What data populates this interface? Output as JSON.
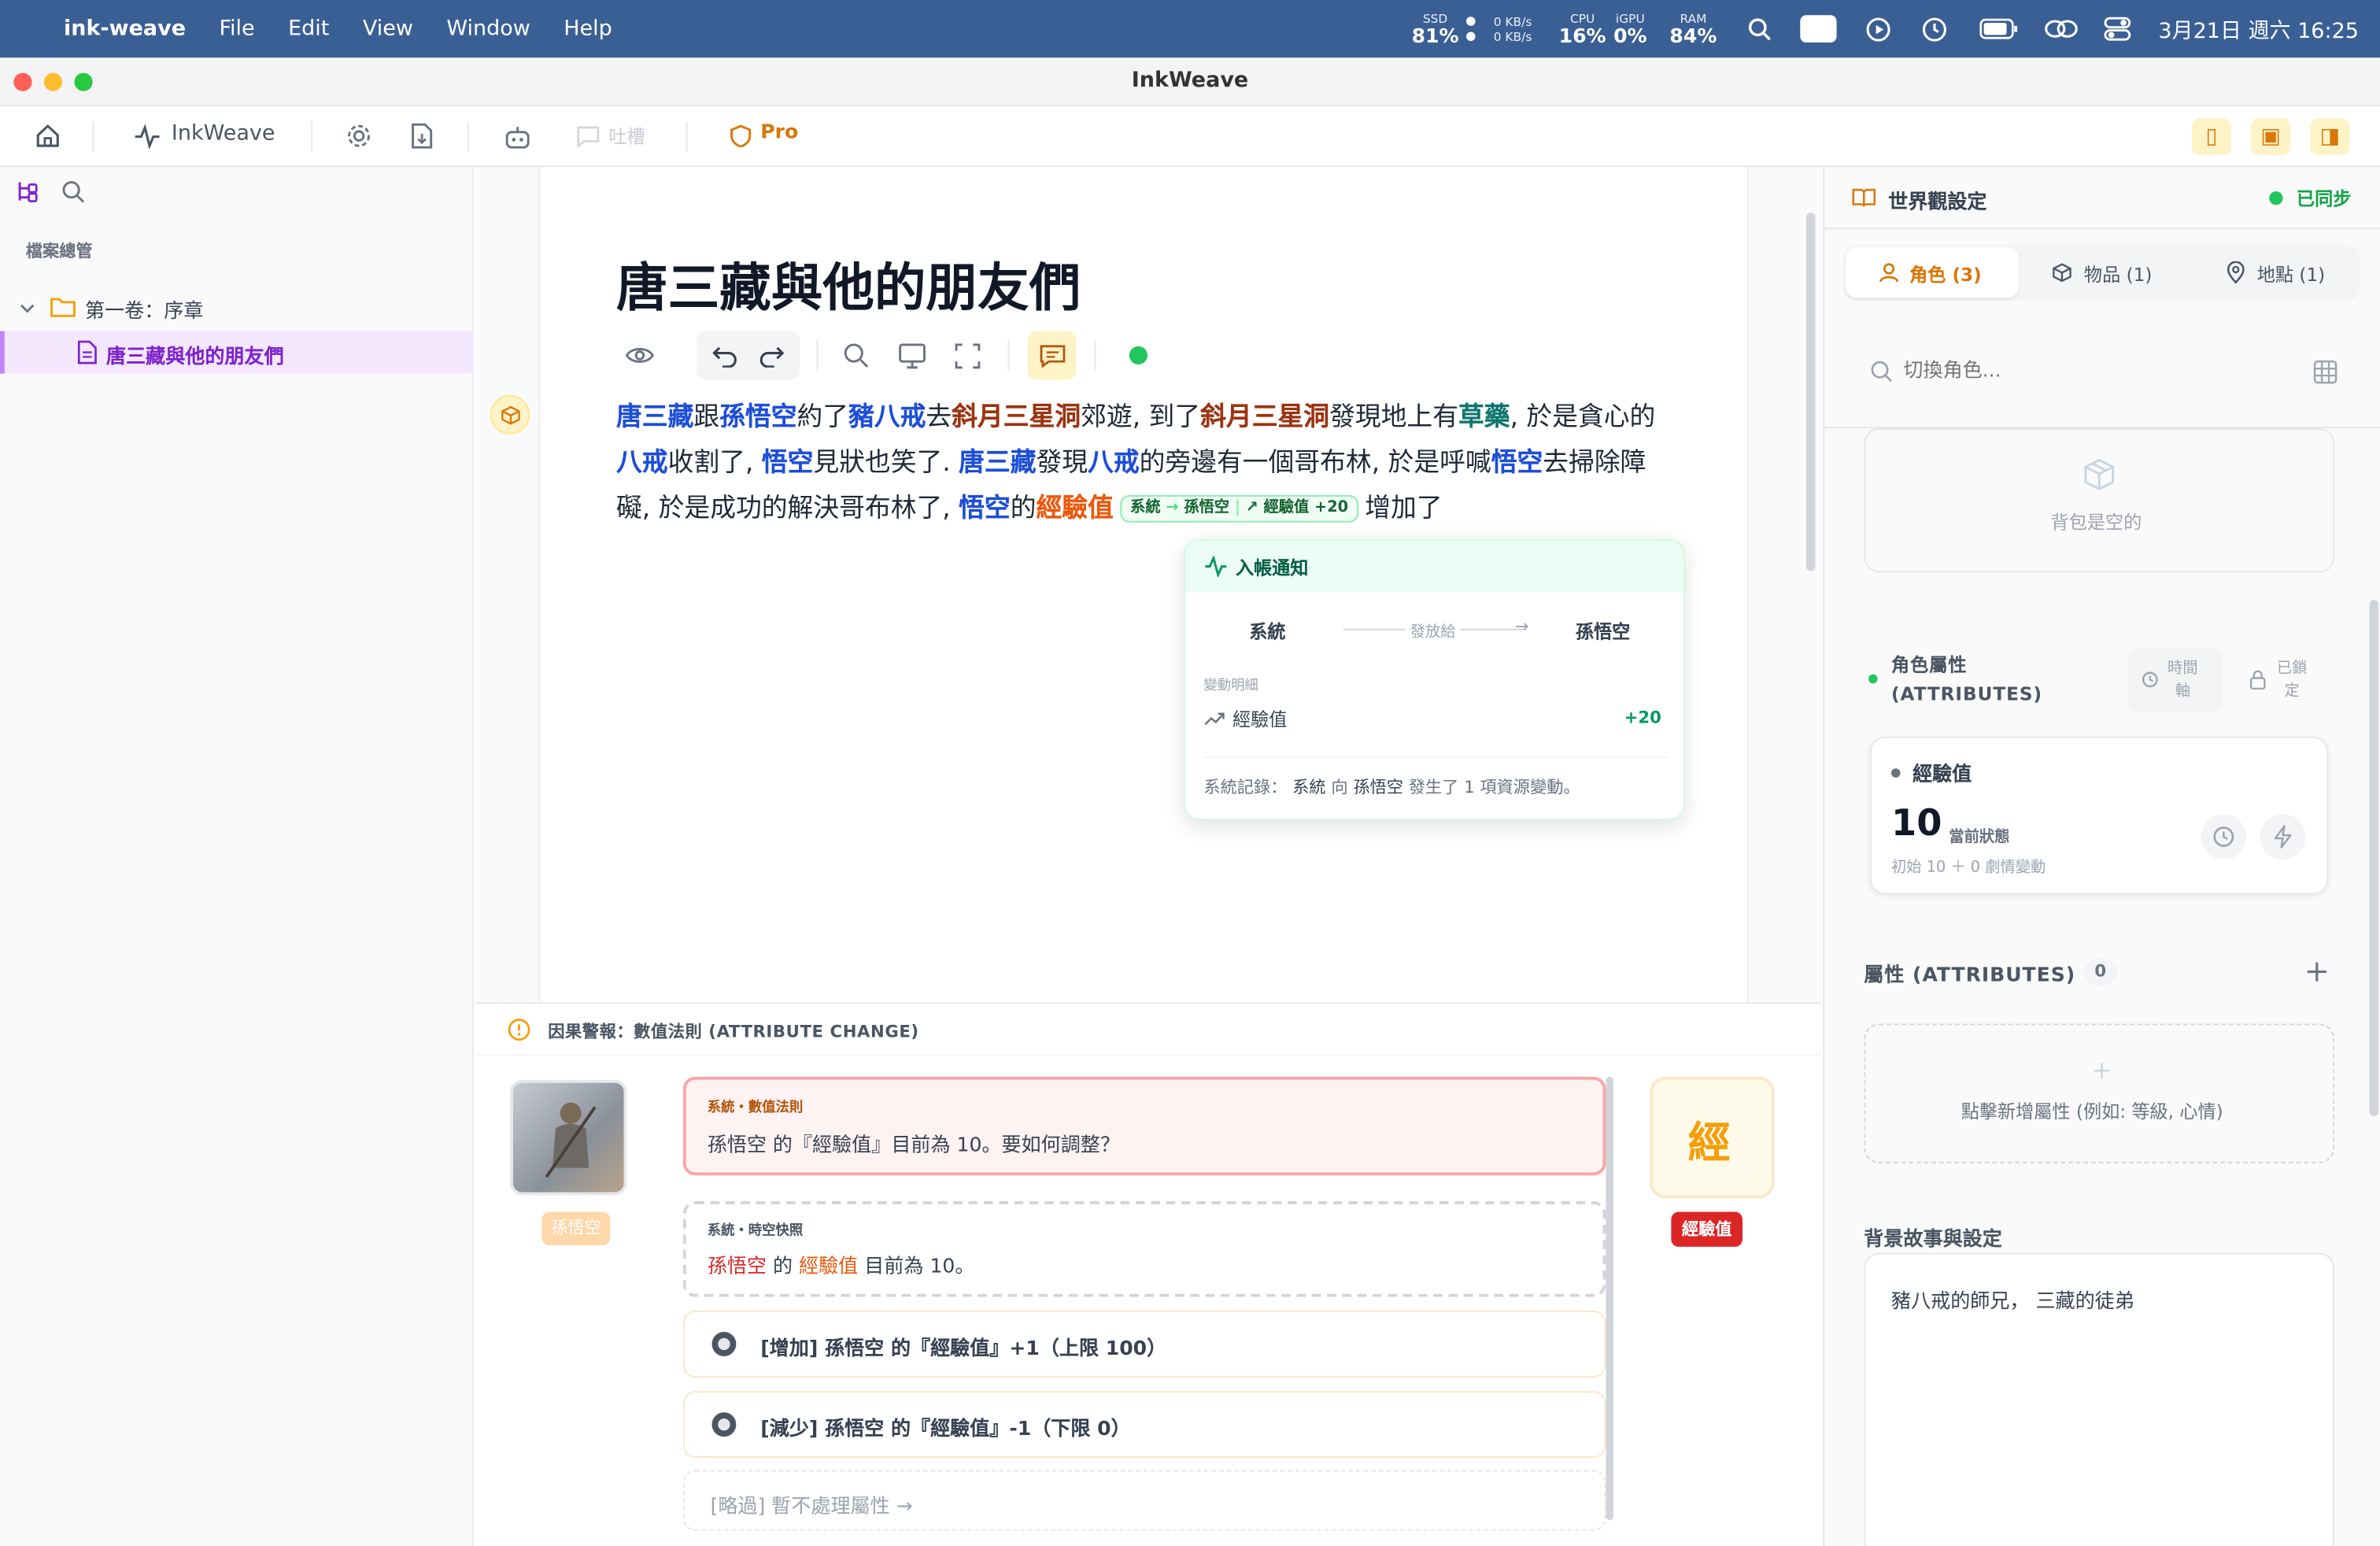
{
  "menubar": {
    "app_name": "ink-weave",
    "menus": [
      "File",
      "Edit",
      "View",
      "Window",
      "Help"
    ],
    "stats": {
      "ssd_label": "SSD",
      "ssd_value": "81%",
      "net_up": "0 KB/s",
      "net_down": "0 KB/s",
      "cpu_label": "CPU",
      "cpu_value": "16%",
      "gpu_label": "iGPU",
      "gpu_value": "0%",
      "ram_label": "RAM",
      "ram_value": "84%"
    },
    "datetime": "3月21日 週六 16:25"
  },
  "window": {
    "title": "InkWeave"
  },
  "toolbar": {
    "brand_label": "InkWeave",
    "feedback_label": "吐槽",
    "pro_label": "Pro"
  },
  "sidebar": {
    "section_title": "檔案總管",
    "folder_label": "第一卷：序章",
    "file_label": "唐三藏與他的朋友們"
  },
  "editor": {
    "title": "唐三藏與他的朋友們",
    "paragraph": [
      {
        "t": "唐三藏",
        "c": "cb"
      },
      {
        "t": "跟"
      },
      {
        "t": "孫悟空",
        "c": "cb"
      },
      {
        "t": "約了"
      },
      {
        "t": "豬八戒",
        "c": "cb"
      },
      {
        "t": "去"
      },
      {
        "t": "斜月三星洞",
        "c": "cs"
      },
      {
        "t": "郊遊, 到了"
      },
      {
        "t": "斜月三星洞",
        "c": "cs"
      },
      {
        "t": "發現地上有"
      },
      {
        "t": "草藥",
        "c": "ci"
      },
      {
        "t": ", 於是貪心的"
      },
      {
        "t": "八戒",
        "c": "cb"
      },
      {
        "t": "收割了, "
      },
      {
        "t": "悟空",
        "c": "cb"
      },
      {
        "t": "見狀也笑了. "
      },
      {
        "t": "唐三藏",
        "c": "cb"
      },
      {
        "t": "發現"
      },
      {
        "t": "八戒",
        "c": "cb"
      },
      {
        "t": "的旁邊有一個哥布林, 於是呼喊"
      },
      {
        "t": "悟空",
        "c": "cb"
      },
      {
        "t": "去掃除障礙, 於是成功的解決哥布林了, "
      },
      {
        "t": "悟空",
        "c": "cb"
      },
      {
        "t": "的"
      },
      {
        "t": "經驗值",
        "c": "co"
      }
    ],
    "chip": {
      "from": "系統",
      "to": "孫悟空",
      "delta": "經驗值 +20"
    },
    "after_chip": "增加了"
  },
  "popup": {
    "title": "入帳通知",
    "sender": "系統",
    "arrow_label": "發放給",
    "receiver": "孫悟空",
    "detail_label": "變動明細",
    "item_name": "經驗值",
    "item_delta": "+20",
    "log_prefix": "系統記錄：",
    "log_from": "系統",
    "log_mid": "向",
    "log_to": "孫悟空",
    "log_suffix": "發生了 1 項資源變動。"
  },
  "alert": {
    "header": "因果警報：數值法則 (ATTRIBUTE CHANGE)",
    "avatar_name": "孫悟空",
    "question_tag": "系統・數值法則",
    "question": "孫悟空 的『經驗值』目前為 10。要如何調整？",
    "snapshot_tag": "系統・時空快照",
    "snapshot_name": "孫悟空",
    "snapshot_mid": "的",
    "snapshot_attr": "經驗值",
    "snapshot_suffix": "目前為 10。",
    "option_increase": "[增加] 孫悟空 的『經驗值』+1（上限 100）",
    "option_decrease": "[減少] 孫悟空 的『經驗值』-1（下限 0）",
    "option_skip": "[略過] 暫不處理屬性 →",
    "attr_glyph": "經",
    "attr_badge": "經驗值"
  },
  "right": {
    "title": "世界觀設定",
    "sync_status": "已同步",
    "tabs": [
      "角色 (3)",
      "物品 (1)",
      "地點 (1)"
    ],
    "search_placeholder": "切換角色...",
    "bag_empty": "背包是空的",
    "attr_section_title": "角色屬性\n(ATTRIBUTES)",
    "timeline_label": "時間\n軸",
    "locked_label": "已鎖\n定",
    "attr_name": "經驗值",
    "attr_value": "10",
    "attr_state": "當前狀態",
    "attr_formula": "初始 10 ＋ 0 劇情變動",
    "attrs_title": "屬性 (ATTRIBUTES)",
    "attrs_count": "0",
    "attrs_add_hint": "點擊新增屬性 (例如: 等級, 心情)",
    "backstory_title": "背景故事與設定",
    "backstory_text": "豬八戒的師兄， 三藏的徒弟"
  },
  "colors": {
    "accent": "#d97706",
    "link": "#1d4ed8",
    "success": "#22c55e",
    "danger": "#dc2626",
    "selected": "#7e22ce"
  }
}
